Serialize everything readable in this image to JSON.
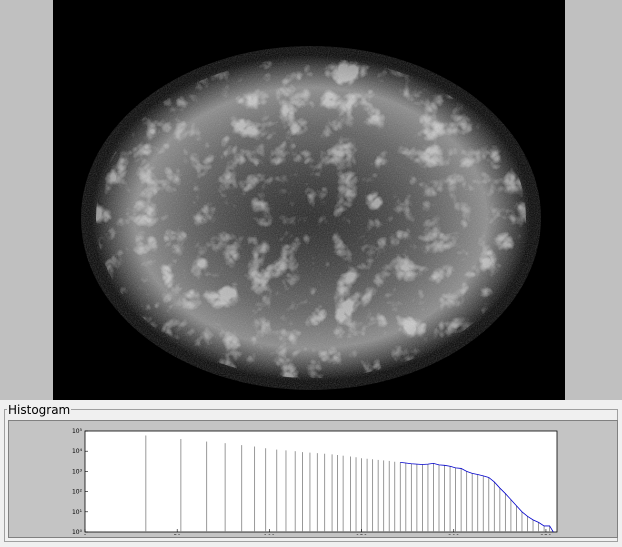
{
  "viewer": {
    "image_alt": "X-ray image of supernova remnant"
  },
  "histogram_panel": {
    "title": "Histogram"
  },
  "chart_data": {
    "type": "bar",
    "title": "",
    "xlabel": "",
    "ylabel": "",
    "xlim": [
      0,
      256
    ],
    "ylim": [
      1,
      100000
    ],
    "yscale": "log",
    "x_ticks": [
      0,
      50,
      100,
      150,
      200,
      250
    ],
    "y_ticks": [
      1,
      10,
      100,
      1000,
      10000,
      100000
    ],
    "y_tick_labels": [
      "10⁰",
      "10¹",
      "10²",
      "10³",
      "10⁴",
      "10⁵"
    ],
    "grid": false,
    "line_color": "#0000cc",
    "bar_color": "#7f7f7f",
    "x": [
      33,
      52,
      66,
      76,
      85,
      92,
      98,
      104,
      109,
      114,
      118,
      122,
      126,
      130,
      134,
      137,
      140,
      144,
      147,
      150,
      153,
      156,
      159,
      162,
      165,
      168,
      171,
      174,
      177,
      180,
      183,
      186,
      189,
      192,
      195,
      198,
      201,
      204,
      207,
      210,
      213,
      216,
      219,
      222,
      225,
      228,
      231,
      234,
      237,
      240,
      243,
      246,
      249,
      252,
      254
    ],
    "values": [
      60000,
      40000,
      30000,
      25000,
      20000,
      17000,
      14000,
      12000,
      11000,
      10000,
      9000,
      8500,
      8000,
      7500,
      7000,
      6500,
      6000,
      5500,
      5000,
      4500,
      4200,
      4000,
      3700,
      3500,
      3300,
      3000,
      2800,
      2600,
      2400,
      2300,
      2200,
      2300,
      2500,
      2100,
      2000,
      1800,
      1500,
      1400,
      1000,
      800,
      700,
      600,
      500,
      300,
      150,
      80,
      40,
      20,
      10,
      6,
      4,
      3,
      2,
      2,
      1
    ]
  }
}
